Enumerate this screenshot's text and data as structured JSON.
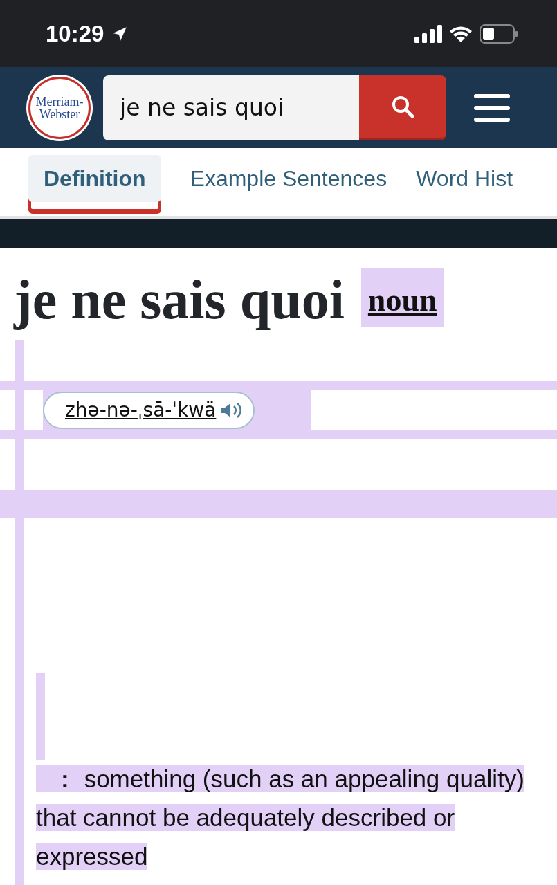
{
  "status_bar": {
    "time": "10:29"
  },
  "header": {
    "logo_lines": [
      "Merriam-",
      "Webster"
    ],
    "search": {
      "value": "je ne sais quoi"
    }
  },
  "tabs": [
    {
      "label": "Definition",
      "selected": true
    },
    {
      "label": "Example Sentences",
      "selected": false
    },
    {
      "label": "Word Hist",
      "selected": false
    }
  ],
  "entry": {
    "headword": "je ne sais quoi",
    "part_of_speech": "noun",
    "pronunciation": "zhə-nə-ˌsā-ˈkwä",
    "definition_mark": ":",
    "definition": "something (such as an appealing quality) that cannot be adequately described or expressed"
  }
}
